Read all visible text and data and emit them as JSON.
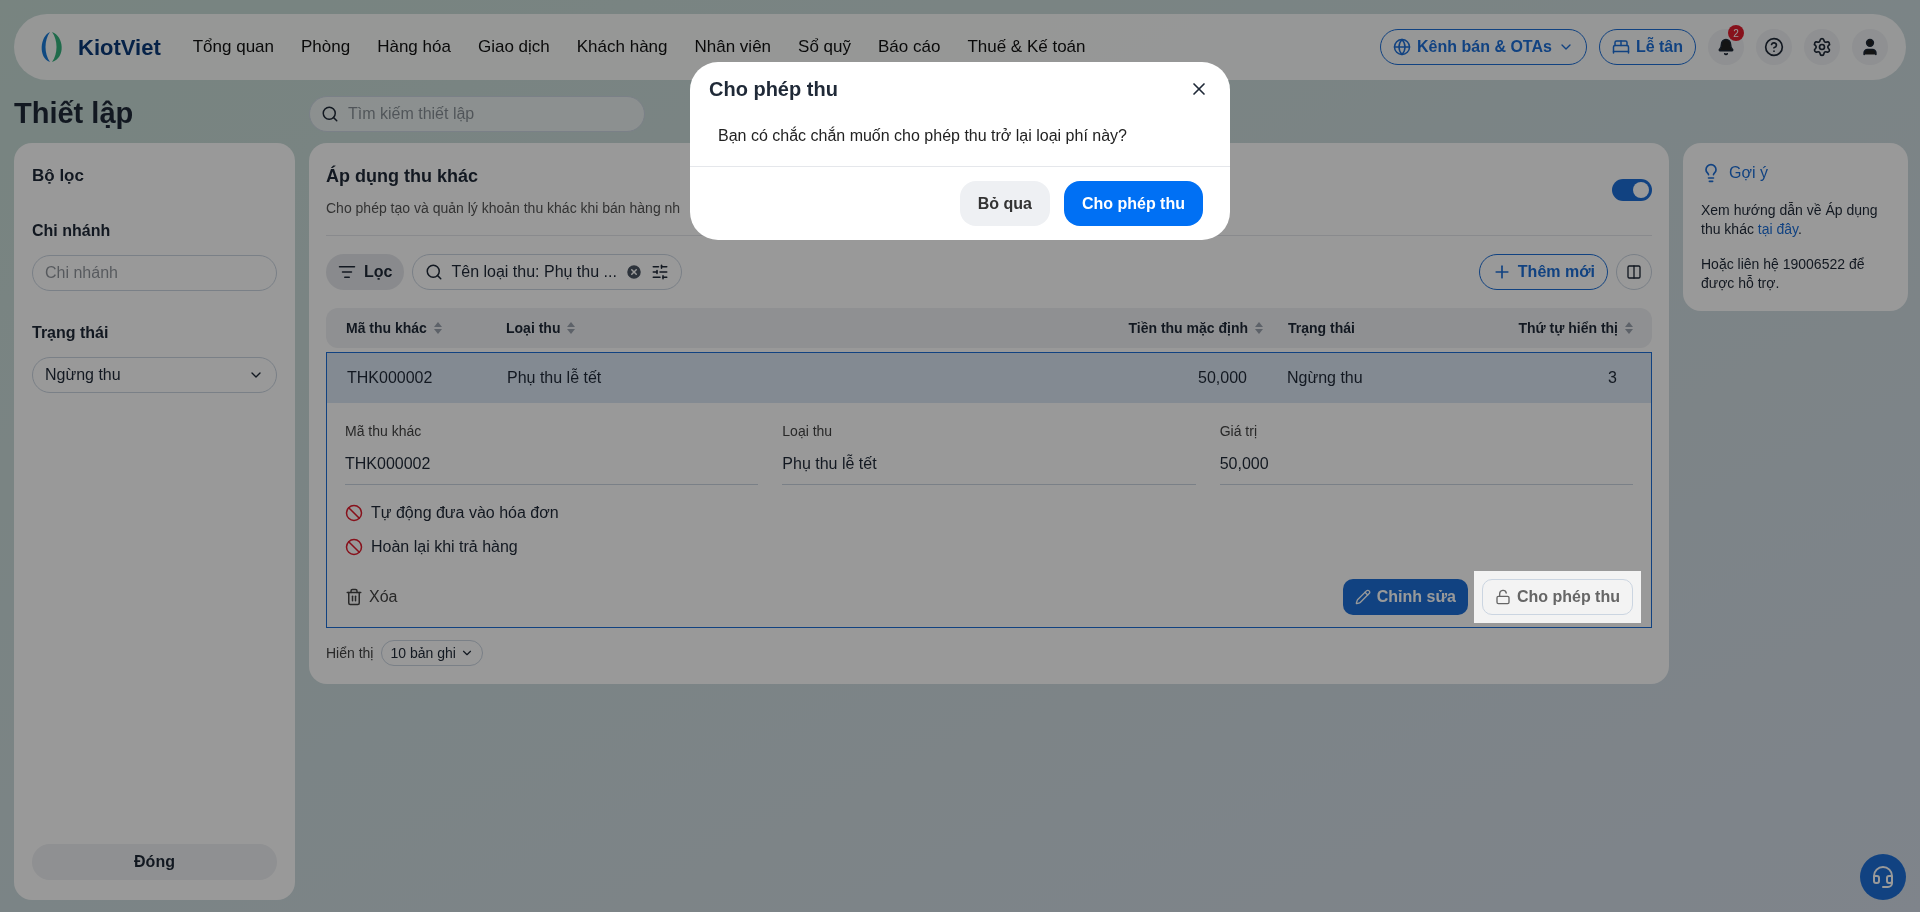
{
  "nav": {
    "logo": "KiotViet",
    "items": [
      {
        "label": "Tổng quan"
      },
      {
        "label": "Phòng"
      },
      {
        "label": "Hàng hóa"
      },
      {
        "label": "Giao dịch"
      },
      {
        "label": "Khách hàng"
      },
      {
        "label": "Nhân viên"
      },
      {
        "label": "Sổ quỹ"
      },
      {
        "label": "Báo cáo"
      },
      {
        "label": "Thuế & Kế toán"
      }
    ],
    "channel_button": "Kênh bán & OTAs",
    "reception_button": "Lễ tân",
    "notification_count": "2"
  },
  "page_title": "Thiết lập",
  "search": {
    "placeholder": "Tìm kiếm thiết lập"
  },
  "filter_panel": {
    "title": "Bộ lọc",
    "branch": {
      "label": "Chi nhánh",
      "placeholder": "Chi nhánh"
    },
    "status": {
      "label": "Trạng thái",
      "value": "Ngừng thu"
    },
    "close_button": "Đóng"
  },
  "main": {
    "title": "Áp dụng thu khác",
    "description": "Cho phép tạo và quản lý khoản thu khác khi bán hàng nh",
    "toggle": {
      "on": true
    },
    "filter_button": "Lọc",
    "search_chip": "Tên loại thu: Phụ thu ...",
    "add_button": "Thêm mới",
    "table": {
      "columns": [
        {
          "label": "Mã thu khác",
          "sortable": true
        },
        {
          "label": "Loại thu",
          "sortable": true
        },
        {
          "label": "Tiền thu mặc định",
          "sortable": true
        },
        {
          "label": "Trạng thái",
          "sortable": false
        },
        {
          "label": "Thứ tự hiển thị",
          "sortable": true
        }
      ],
      "rows": [
        {
          "cells": [
            "THK000002",
            "Phụ thu lễ tết",
            "50,000",
            "Ngừng thu",
            "3"
          ],
          "selected": true,
          "expanded": true,
          "details": [
            {
              "label": "Mã thu khác",
              "value": "THK000002"
            },
            {
              "label": "Loại thu",
              "value": "Phụ thu lễ tết"
            },
            {
              "label": "Giá trị",
              "value": "50,000"
            }
          ],
          "flags": [
            {
              "label": "Tự động đưa vào hóa đơn",
              "enabled": false
            },
            {
              "label": "Hoàn lại khi trả hàng",
              "enabled": false
            }
          ],
          "delete_button": "Xóa",
          "edit_button": "Chỉnh sửa",
          "allow_button": "Cho phép thu"
        }
      ]
    },
    "footer": {
      "label": "Hiển thị",
      "page_size": "10 bản ghi"
    }
  },
  "hint": {
    "title": "Gợi ý",
    "text": "Xem hướng dẫn về Áp dụng thu khác",
    "link": "tại đây",
    "after_link": ".",
    "contact": "Hoặc liên hệ 19006522 để được hỗ trợ."
  },
  "dialog": {
    "title": "Cho phép thu",
    "message": "Bạn có chắc chắn muốn cho phép thu trở lại loại phí này?",
    "cancel_button": "Bỏ qua",
    "confirm_button": "Cho phép thu"
  }
}
